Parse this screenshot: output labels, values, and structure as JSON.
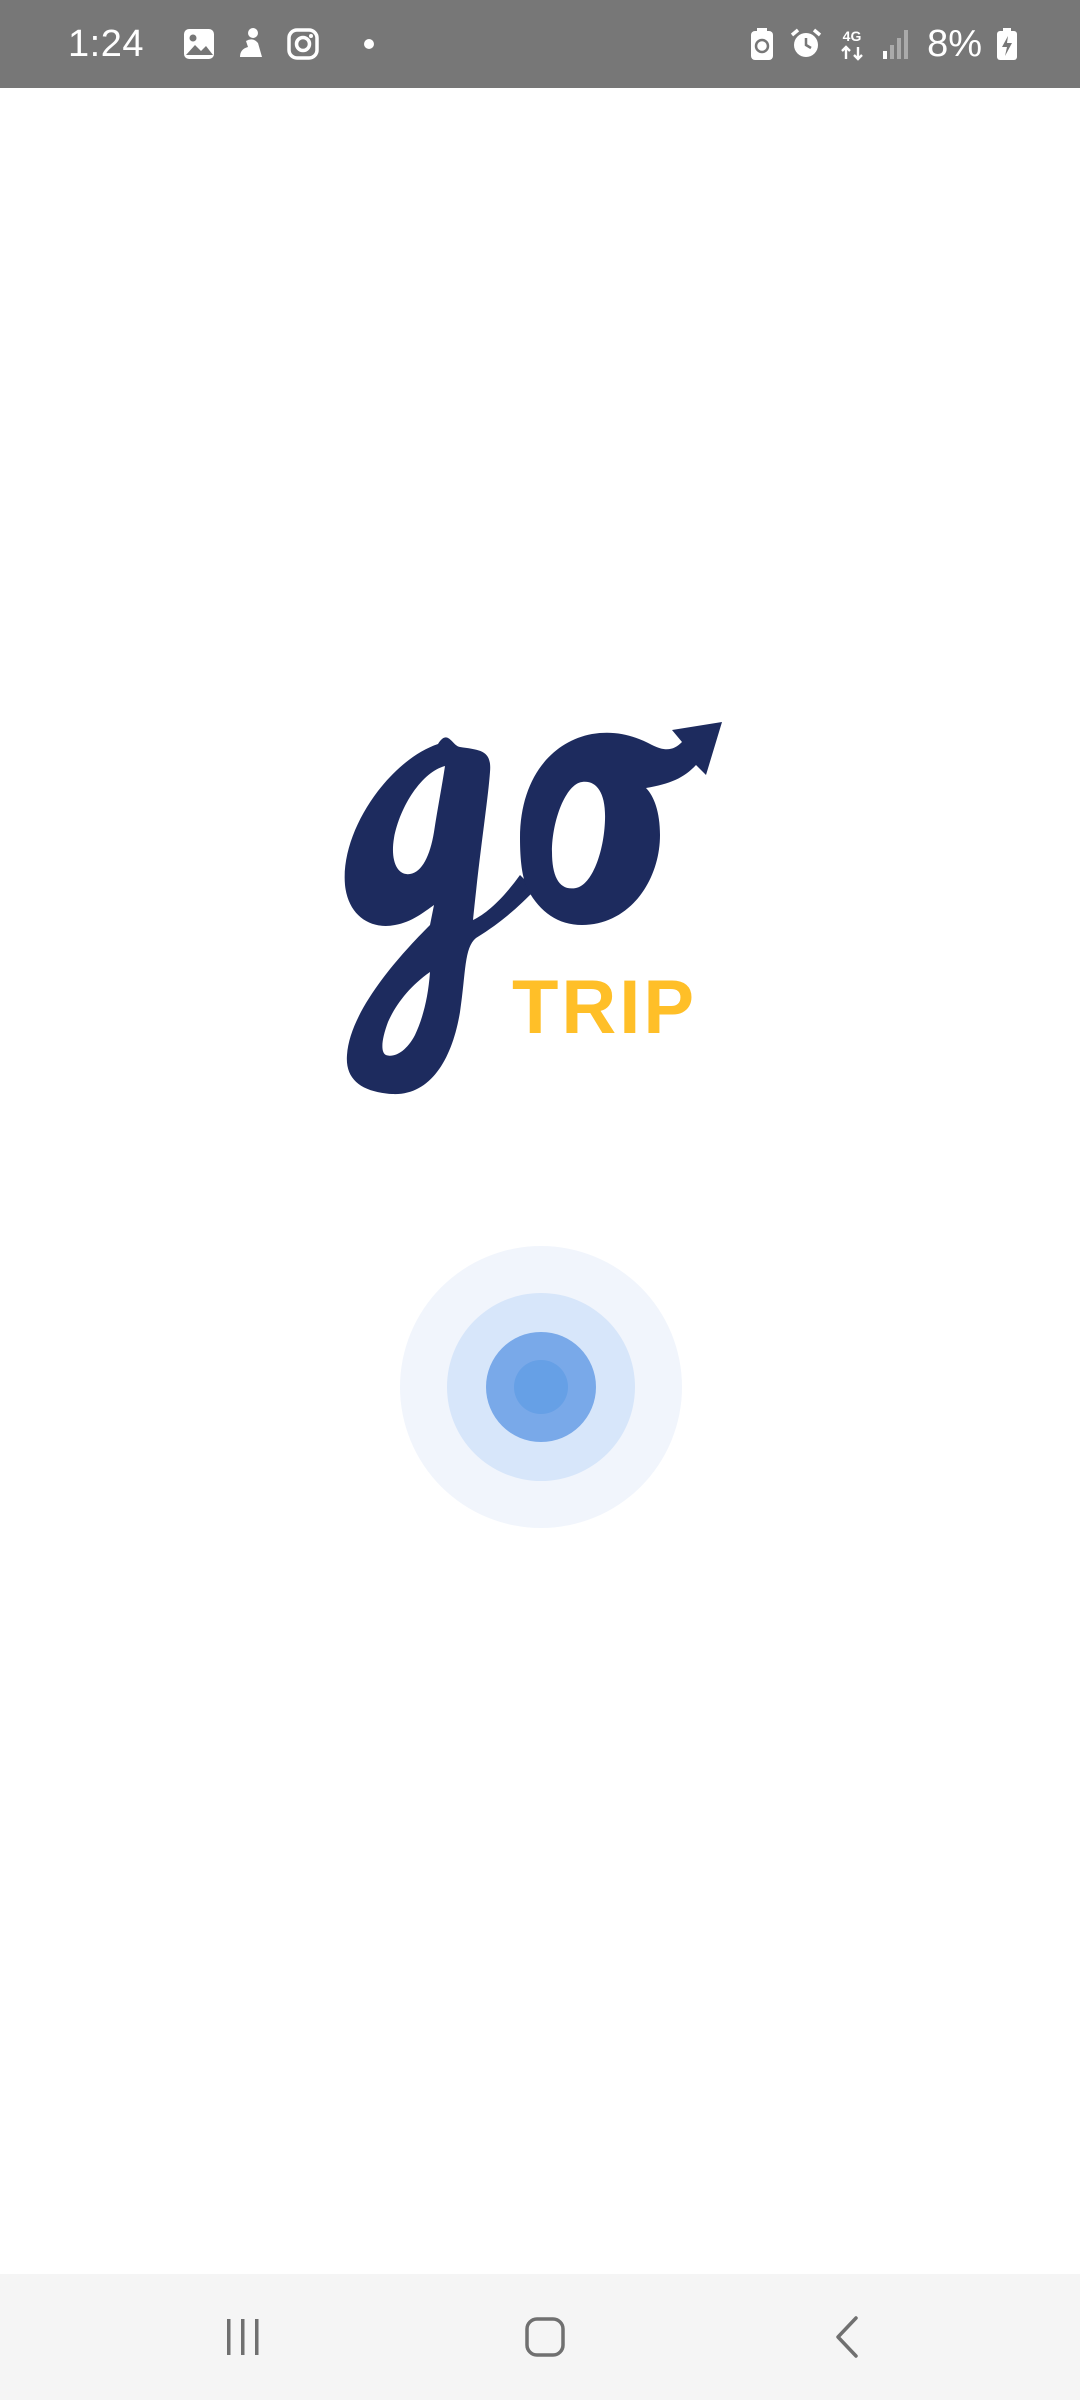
{
  "status_bar": {
    "time": "1:24",
    "battery_percent": "8%",
    "network": "4G",
    "left_icons": [
      "gallery-icon",
      "figure-icon",
      "instagram-icon",
      "notification-dot"
    ],
    "right_icons": [
      "battery-saver-icon",
      "alarm-icon",
      "network-4g-icon",
      "signal-icon",
      "battery-charging-icon"
    ]
  },
  "logo": {
    "word_mark": "go",
    "sub_mark": "TRIP",
    "primary_color": "#1D2B5E",
    "accent_color": "#FFBF28"
  },
  "loader": {
    "colors": [
      "#F1F5FC",
      "#D7E6FA",
      "#79A9E9",
      "#66A0E6"
    ]
  },
  "nav_bar": {
    "buttons": [
      "recents-icon",
      "home-icon",
      "back-icon"
    ]
  }
}
